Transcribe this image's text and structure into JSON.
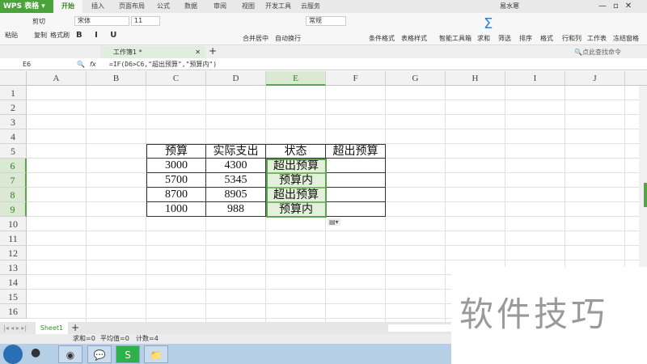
{
  "app": {
    "name": "WPS 表格",
    "user": "易水寒"
  },
  "tabs": [
    "开始",
    "插入",
    "页面布局",
    "公式",
    "数据",
    "审阅",
    "视图",
    "开发工具",
    "云服务"
  ],
  "ribbon": {
    "paste": "粘贴",
    "cut": "剪切",
    "copy": "复制",
    "format_painter": "格式刷",
    "font": "宋体",
    "size": "11",
    "merge": "合并居中",
    "wrap": "自动换行",
    "numfmt": "常规",
    "cond": "条件格式",
    "table_style": "表格样式",
    "smart": "智能工具箱",
    "sum": "求和",
    "filter": "筛选",
    "sort": "排序",
    "format": "格式",
    "rowcol": "行和列",
    "sheet": "工作表",
    "freeze": "冻结窗格",
    "search": "点此查找命令"
  },
  "doc_tab": "工作簿1 *",
  "formula_bar": {
    "cell": "E6",
    "fx": "fx",
    "formula": "=IF(D6>C6,\"超出预算\",\"预算内\")"
  },
  "columns": [
    "A",
    "B",
    "C",
    "D",
    "E",
    "F",
    "G",
    "H",
    "I",
    "J"
  ],
  "rows": [
    "1",
    "2",
    "3",
    "4",
    "5",
    "6",
    "7",
    "8",
    "9",
    "10",
    "11",
    "12",
    "13",
    "14",
    "15",
    "16"
  ],
  "table": {
    "header": [
      "预算",
      "实际支出",
      "状态",
      "超出预算"
    ],
    "rows": [
      [
        "3000",
        "4300",
        "超出预算",
        ""
      ],
      [
        "5700",
        "5345",
        "预算内",
        ""
      ],
      [
        "8700",
        "8905",
        "超出预算",
        ""
      ],
      [
        "1000",
        "988",
        "预算内",
        ""
      ]
    ]
  },
  "sheet_tab": "Sheet1",
  "status": {
    "sum": "求和=0",
    "avg": "平均值=0",
    "count": "计数=4"
  },
  "watermark": "软件技巧"
}
